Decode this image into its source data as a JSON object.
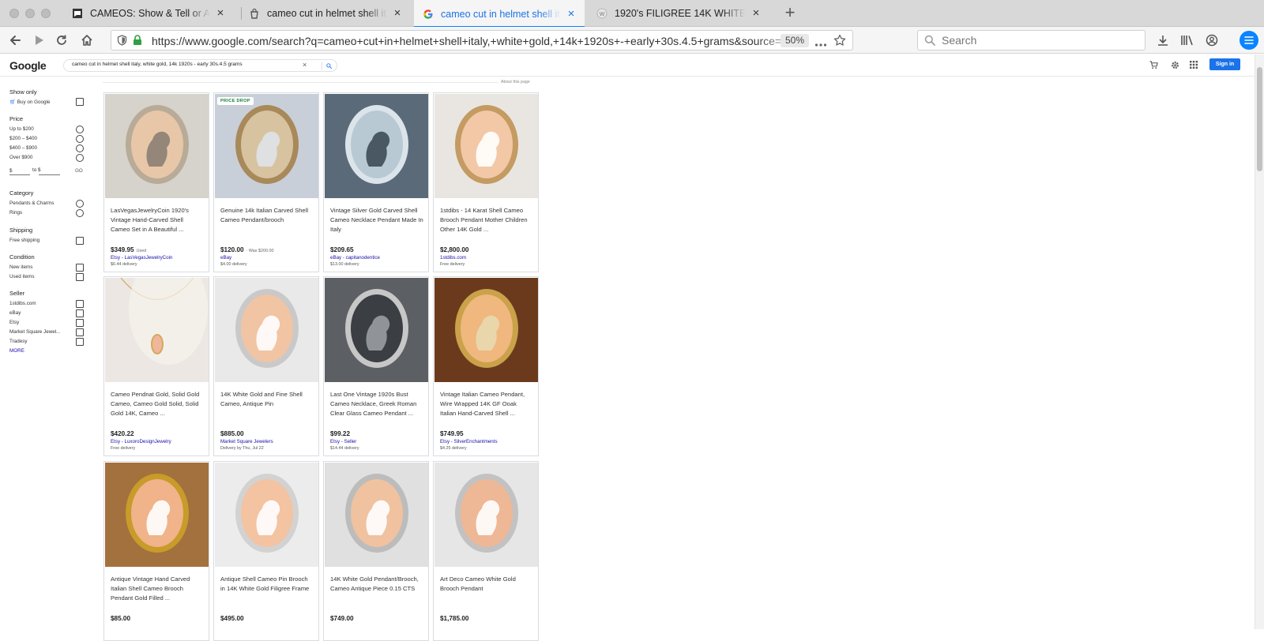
{
  "browser": {
    "tabs": [
      {
        "title": "CAMEOS: Show & Tell or Ask & ",
        "active": false,
        "favicon": "forum-favicon"
      },
      {
        "title": "cameo cut in helmet shell italy, ",
        "active": false,
        "favicon": "shopping-bag-favicon"
      },
      {
        "title": "cameo cut in helmet shell italy, ",
        "active": true,
        "favicon": "google-favicon"
      },
      {
        "title": "1920's FILIGREE 14K WHITE GO",
        "active": false,
        "favicon": "worthpoint-favicon"
      }
    ],
    "url": "https://www.google.com/search?q=cameo+cut+in+helmet+shell+italy,+white+gold,+14k+1920s+-+early+30s.4.5+grams&source=",
    "zoom": "50%",
    "search_placeholder": "Search"
  },
  "google": {
    "logo": "Google",
    "query": "cameo cut in helmet shell italy, white gold, 14k 1920s - early 30s.4.5 grams",
    "clear": "×",
    "sign_in": "Sign in",
    "about": "About this page"
  },
  "filters": {
    "show_only": {
      "title": "Show only",
      "items": [
        "Buy on Google"
      ]
    },
    "price": {
      "title": "Price",
      "items": [
        "Up to $200",
        "$200 – $400",
        "$400 – $900",
        "Over $900"
      ],
      "min_prefix": "$",
      "to_label": "to $",
      "go_label": "GO"
    },
    "category": {
      "title": "Category",
      "items": [
        "Pendants & Charms",
        "Rings"
      ]
    },
    "shipping": {
      "title": "Shipping",
      "items": [
        "Free shipping"
      ]
    },
    "condition": {
      "title": "Condition",
      "items": [
        "New items",
        "Used items"
      ]
    },
    "seller": {
      "title": "Seller",
      "items": [
        "1stdibs.com",
        "eBay",
        "Etsy",
        "Market Square Jewel...",
        "Tradesy"
      ],
      "more": "MORE"
    }
  },
  "products": [
    {
      "title": "LasVegasJewelryCoin 1920's Vintage Hand-Carved Shell Cameo Set in A Beautiful ...",
      "price": "$349.95",
      "note": "Used",
      "merchant": "Etsy - LasVegasJewelryCoin",
      "delivery": "$6.44 delivery",
      "badge": ""
    },
    {
      "title": "Genuine 14k Italian Carved Shell Cameo Pendant/brooch",
      "price": "$120.00",
      "note": "· Was $200.00",
      "merchant": "eBay",
      "delivery": "$4.00 delivery",
      "badge": "PRICE DROP"
    },
    {
      "title": "Vintage Silver Gold Carved Shell Cameo Necklace Pendant Made In Italy",
      "price": "$209.65",
      "note": "",
      "merchant": "eBay - capitanodentice",
      "delivery": "$13.00 delivery",
      "badge": ""
    },
    {
      "title": "1stdibs - 14 Karat Shell Cameo Brooch Pendant Mother Children Other 14K Gold ...",
      "price": "$2,800.00",
      "note": "",
      "merchant": "1stdibs.com",
      "delivery": "Free delivery",
      "badge": ""
    },
    {
      "title": "Cameo Pendnat Gold, Solid Gold Cameo, Cameo Gold Solid, Solid Gold 14K, Cameo ...",
      "price": "$420.22",
      "note": "",
      "merchant": "Etsy - LuxoroDesignJewelry",
      "delivery": "Free delivery",
      "badge": ""
    },
    {
      "title": "14K White Gold and Fine Shell Cameo, Antique Pin",
      "price": "$885.00",
      "note": "",
      "merchant": "Market Square Jewelers",
      "delivery": "Delivery by Thu, Jul 22",
      "badge": ""
    },
    {
      "title": "Last One Vintage 1920s Bust Cameo Necklace, Greek Roman Clear Glass Cameo Pendant ...",
      "price": "$99.22",
      "note": "",
      "merchant": "Etsy - Seller",
      "delivery": "$14.44 delivery",
      "badge": ""
    },
    {
      "title": "Vintage Italian Cameo Pendant, Wire Wrapped 14K GF Ooak Italian Hand-Carved Shell ...",
      "price": "$749.95",
      "note": "",
      "merchant": "Etsy - SilverEnchantments",
      "delivery": "$4.25 delivery",
      "badge": ""
    },
    {
      "title": "Antique Vintage Hand Carved Italian Shell Cameo Brooch Pendant Gold Filled ...",
      "price": "$85.00",
      "note": "",
      "merchant": "",
      "delivery": "",
      "badge": ""
    },
    {
      "title": "Antique Shell Cameo Pin Brooch in 14K White Gold Filigree Frame",
      "price": "$495.00",
      "note": "",
      "merchant": "",
      "delivery": "",
      "badge": ""
    },
    {
      "title": "14K White Gold Pendant/Brooch, Cameo Antique Piece 0.15 CTS",
      "price": "$749.00",
      "note": "",
      "merchant": "",
      "delivery": "",
      "badge": ""
    },
    {
      "title": "Art Deco Cameo White Gold Brooch Pendant",
      "price": "$1,785.00",
      "note": "",
      "merchant": "",
      "delivery": "",
      "badge": ""
    }
  ],
  "product_images": [
    {
      "bg": "#d6d2cc",
      "shape": "oval",
      "frame": "#b8ab98",
      "body": "#e8c7a8",
      "accent": "#8b8074"
    },
    {
      "bg": "#c9cfd8",
      "shape": "oval",
      "frame": "#a8895a",
      "body": "#d8c3a0",
      "accent": "#dfe3e8"
    },
    {
      "bg": "#5b6a78",
      "shape": "oval",
      "frame": "#dbe4ea",
      "body": "#b9c9d4",
      "accent": "#3e4b57"
    },
    {
      "bg": "#e9e6e1",
      "shape": "oval",
      "frame": "#c49b62",
      "body": "#f2c8a6",
      "accent": "#ffffff"
    },
    {
      "bg": "#ece7e2",
      "shape": "pendant",
      "frame": "#d3a95c",
      "body": "#f0b69a",
      "accent": "#f7f3ee"
    },
    {
      "bg": "#e9e9e9",
      "shape": "oval",
      "frame": "#c9c9c9",
      "body": "#f1c4a4",
      "accent": "#ffffff"
    },
    {
      "bg": "#5c5f63",
      "shape": "oval",
      "frame": "#c7c7c7",
      "body": "#3b3e42",
      "accent": "#9a9da2"
    },
    {
      "bg": "#6b3a1d",
      "shape": "oval",
      "frame": "#c9a24a",
      "body": "#f0b77f",
      "accent": "#e8d9b0"
    },
    {
      "bg": "#a3713d",
      "shape": "oval",
      "frame": "#c89b2a",
      "body": "#f1b38a",
      "accent": "#ffffff"
    },
    {
      "bg": "#ececec",
      "shape": "oval",
      "frame": "#d2d2d2",
      "body": "#f3c3a2",
      "accent": "#ffffff"
    },
    {
      "bg": "#e0e0e0",
      "shape": "oval",
      "frame": "#bcbcbc",
      "body": "#f0c2a0",
      "accent": "#ffffff"
    },
    {
      "bg": "#e6e6e6",
      "shape": "oval",
      "frame": "#c2c2c2",
      "body": "#eeb795",
      "accent": "#ffffff"
    }
  ],
  "colors": {
    "accent": "#1a73e8",
    "link": "#1a0dab",
    "price_drop": "#188038"
  }
}
